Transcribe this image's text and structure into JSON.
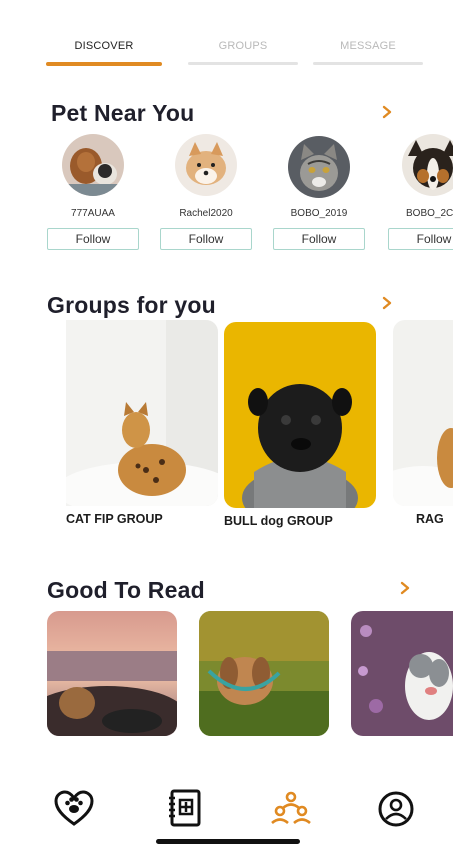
{
  "tabs": [
    {
      "label": "DISCOVER",
      "active": true
    },
    {
      "label": "GROUPS",
      "active": false
    },
    {
      "label": "MESSAGE",
      "active": false
    }
  ],
  "pets_section": {
    "title": "Pet Near You",
    "pets": [
      {
        "name": "777AUAA",
        "follow_label": "Follow"
      },
      {
        "name": "Rachel2020",
        "follow_label": "Follow"
      },
      {
        "name": "BOBO_2019",
        "follow_label": "Follow"
      },
      {
        "name": "BOBO_2C",
        "follow_label": "Follow"
      }
    ]
  },
  "groups_section": {
    "title": "Groups for you",
    "groups": [
      {
        "label": "CAT FIP GROUP"
      },
      {
        "label": "BULL dog GROUP"
      },
      {
        "label": "RAG"
      }
    ]
  },
  "read_section": {
    "title": "Good To Read",
    "articles": [
      "sunset-beach-dog-photo",
      "puppy-on-grass-photo",
      "pitbull-in-flowers-photo"
    ]
  },
  "bottom_nav": {
    "items": [
      "paw-heart-icon",
      "pet-record-icon",
      "community-icon",
      "profile-icon"
    ],
    "active_index": 2
  },
  "colors": {
    "accent": "#e08a22",
    "follow_border": "#a9d6cc",
    "tab_inactive": "#b9b9b9"
  }
}
